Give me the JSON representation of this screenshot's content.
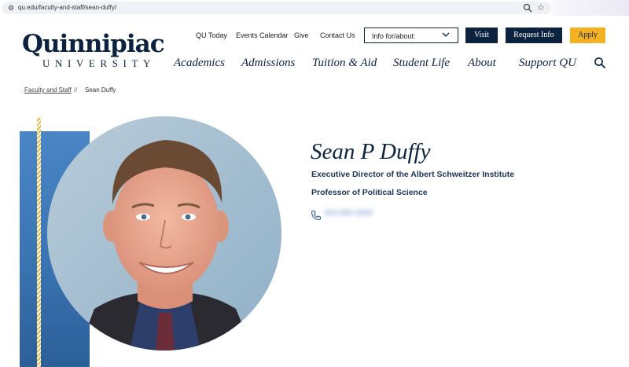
{
  "browser": {
    "url": "qu.edu/faculty-and-staff/sean-duffy/"
  },
  "logo": {
    "wordmark": "Quinnipiac",
    "subtitle": "UNIVERSITY"
  },
  "utility_nav": {
    "items": [
      "QU Today",
      "Events Calendar",
      "Give",
      "Contact Us"
    ],
    "dropdown_label": "Info for/about:",
    "visit_label": "Visit",
    "request_label": "Request Info",
    "apply_label": "Apply"
  },
  "main_nav": {
    "items": [
      "Academics",
      "Admissions",
      "Tuition & Aid",
      "Student Life",
      "About",
      "Support QU"
    ]
  },
  "breadcrumb": {
    "parent": "Faculty and Staff",
    "separator": "//",
    "current": "Sean Duffy"
  },
  "profile": {
    "name": "Sean P Duffy",
    "titles": [
      "Executive Director of the Albert Schweitzer Institute",
      "Professor of Political Science"
    ],
    "phone": "203-582-0000"
  },
  "colors": {
    "navy": "#0c2340",
    "gold": "#f4b223",
    "panel_blue": "#3a74b3"
  }
}
